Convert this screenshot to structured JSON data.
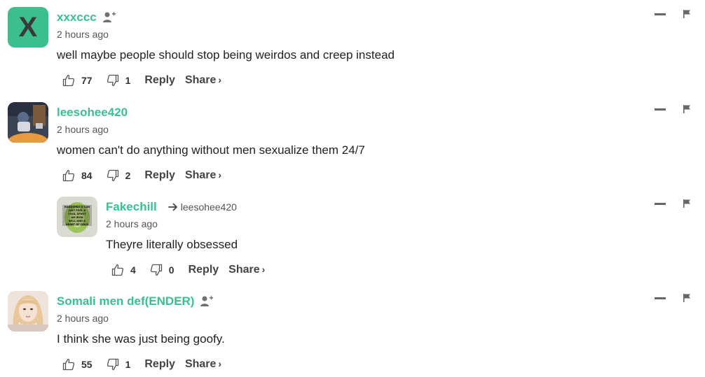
{
  "comments": [
    {
      "username": "xxxccc",
      "avatar_letter": "X",
      "avatar_color": "#3cbf8e",
      "timestamp": "2 hours ago",
      "text": "well maybe people should stop being weirdos and creep instead",
      "likes": "77",
      "dislikes": "1",
      "reply_label": "Reply",
      "share_label": "Share",
      "show_follow": true
    },
    {
      "username": "leesohee420",
      "timestamp": "2 hours ago",
      "text": "women can't do anything without men sexualize them 24/7",
      "likes": "84",
      "dislikes": "2",
      "reply_label": "Reply",
      "share_label": "Share",
      "show_follow": false
    },
    {
      "username": "Fakechill",
      "reply_to": "leesohee420",
      "avatar_text": "RANDOMLY U CAN JUST FEEL A COOL SPIRIT AN IRON WILL AND A HEART OF GOLD",
      "timestamp": "2 hours ago",
      "text": "Theyre literally obsessed",
      "likes": "4",
      "dislikes": "0",
      "reply_label": "Reply",
      "share_label": "Share",
      "show_follow": false
    },
    {
      "username": "Somali men def(ENDER)",
      "timestamp": "2 hours ago",
      "text": "I think she was just being goofy.",
      "likes": "55",
      "dislikes": "1",
      "reply_label": "Reply",
      "share_label": "Share",
      "show_follow": true
    }
  ],
  "icons": {
    "like": "thumbs-up-icon",
    "dislike": "thumbs-down-icon",
    "follow": "add-user-icon",
    "collapse": "collapse-icon",
    "flag": "flag-icon",
    "reply_arrow": "arrow-right-icon"
  },
  "colors": {
    "username": "#3cbf8e",
    "accent": "#3cbf8e"
  }
}
